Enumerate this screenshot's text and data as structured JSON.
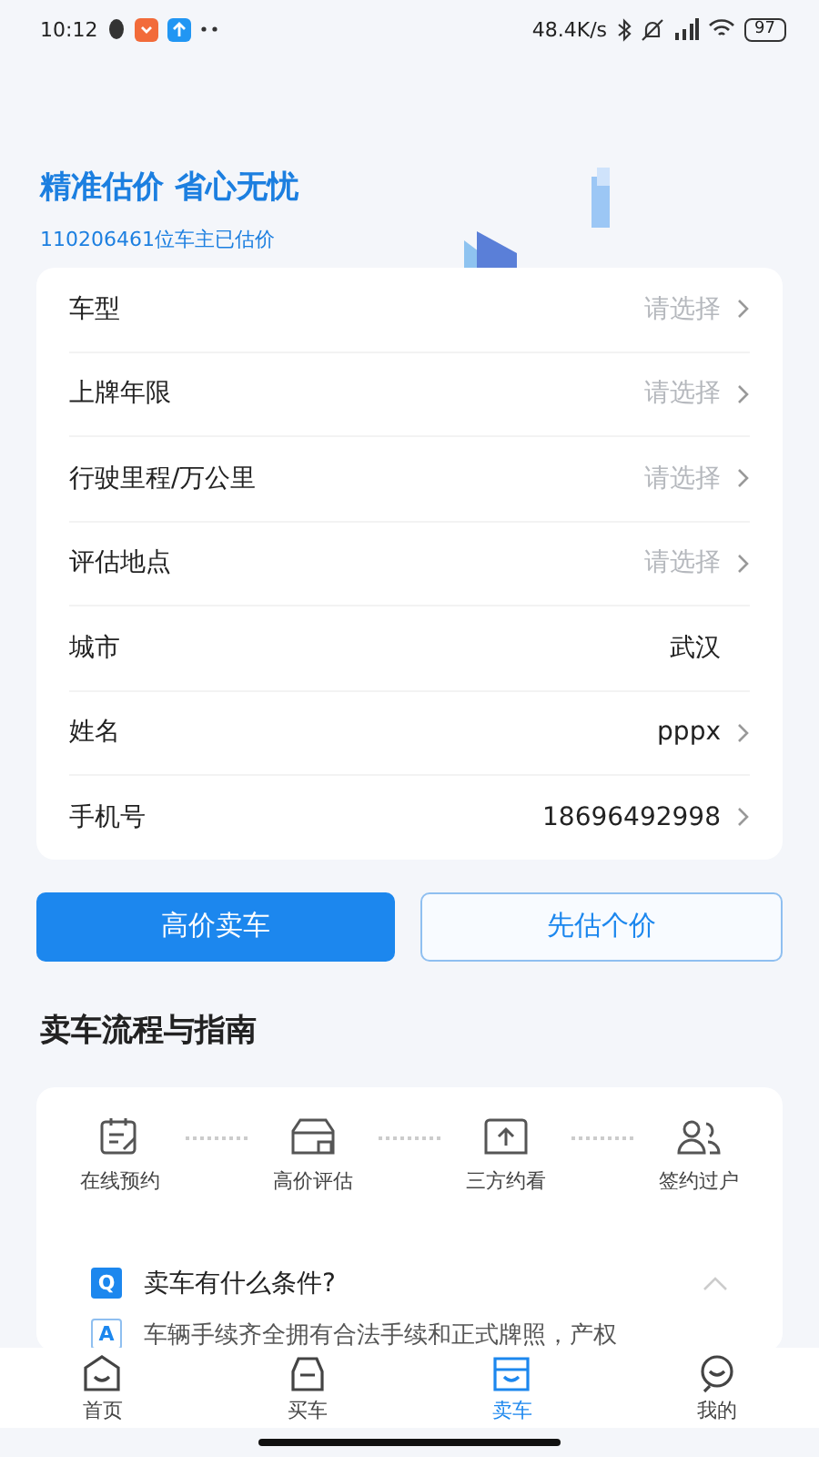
{
  "status_bar": {
    "time": "10:12",
    "speed": "48.4K/s",
    "battery": "97"
  },
  "hero": {
    "title": "精准估价 省心无忧",
    "subtitle": "110206461位车主已估价"
  },
  "form": {
    "rows": [
      {
        "label": "车型",
        "placeholder": "请选择",
        "arrow": true
      },
      {
        "label": "上牌年限",
        "placeholder": "请选择",
        "arrow": true
      },
      {
        "label": "行驶里程/万公里",
        "placeholder": "请选择",
        "arrow": true
      },
      {
        "label": "评估地点",
        "placeholder": "请选择",
        "arrow": true
      },
      {
        "label": "城市",
        "value": "武汉",
        "arrow": false
      },
      {
        "label": "姓名",
        "value": "pppx",
        "arrow": true
      },
      {
        "label": "手机号",
        "value": "18696492998",
        "arrow": true
      }
    ]
  },
  "buttons": [
    {
      "label": "高价卖车",
      "kind": "primary"
    },
    {
      "label": "先估个价",
      "kind": "outline"
    }
  ],
  "guide": {
    "title": "卖车流程与指南",
    "steps": [
      {
        "label": "在线预约"
      },
      {
        "label": "高价评估"
      },
      {
        "label": "三方约看"
      },
      {
        "label": "签约过户"
      }
    ],
    "faq": {
      "question_mark": "Q",
      "question": "卖车有什么条件?",
      "answer_mark": "A",
      "answer": "车辆手续齐全拥有合法手续和正式牌照，产权",
      "expanded": true
    }
  },
  "tabbar": [
    {
      "label": "首页",
      "selected": false
    },
    {
      "label": "买车",
      "selected": false
    },
    {
      "label": "卖车",
      "selected": true
    },
    {
      "label": "我的",
      "selected": false
    }
  ]
}
